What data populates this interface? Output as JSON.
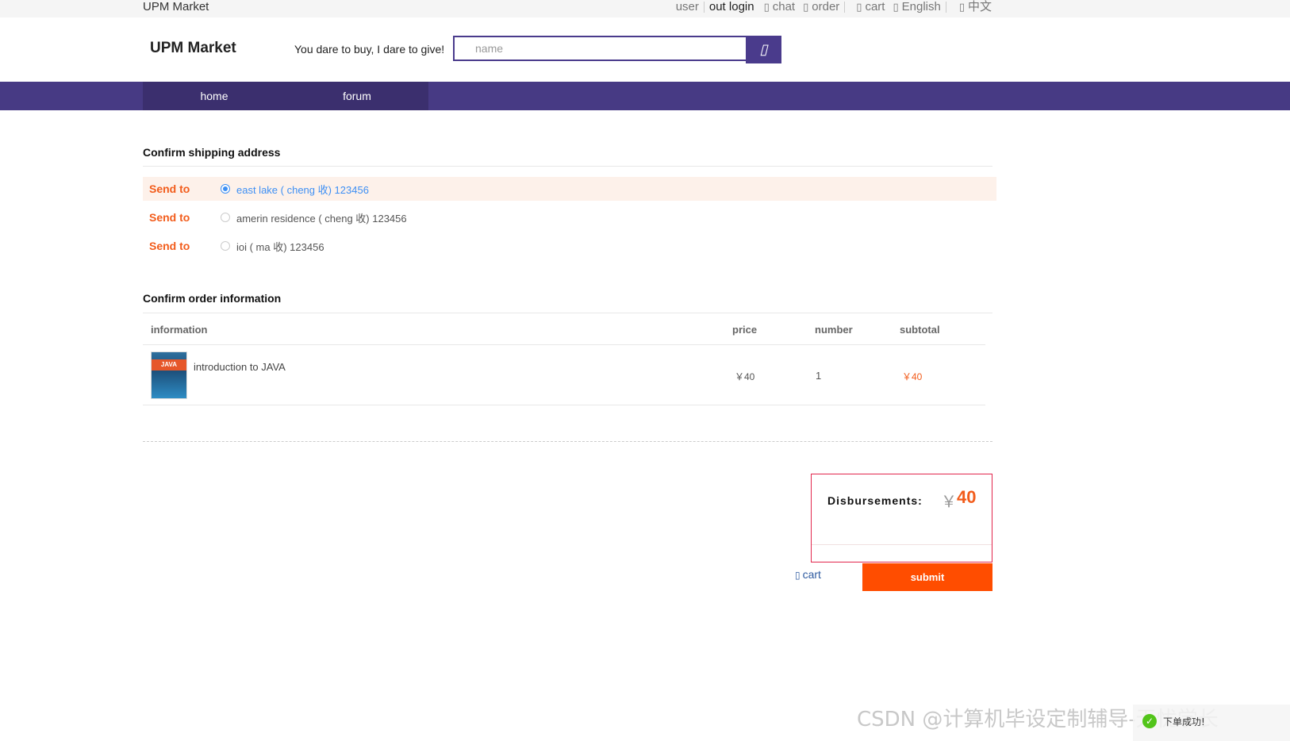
{
  "topbar": {
    "site": "UPM Market",
    "links": {
      "user": "user",
      "logout": "out login",
      "chat": "chat",
      "order": "order",
      "cart": "cart",
      "english": "English",
      "chinese": "中文"
    },
    "icon_glyph": "▯"
  },
  "header": {
    "logo": "UPM Market",
    "slogan": "You dare to buy, I dare to give!",
    "search_placeholder": "name",
    "search_icon": "search-icon"
  },
  "nav": {
    "items": [
      {
        "label": "home"
      },
      {
        "label": "forum"
      }
    ]
  },
  "shipping": {
    "title": "Confirm shipping address",
    "send_label": "Send to",
    "addresses": [
      {
        "text": "east lake ( cheng 收)  123456",
        "selected": true
      },
      {
        "text": "amerin residence ( cheng 收)  123456",
        "selected": false
      },
      {
        "text": "ioi ( ma 收)  123456",
        "selected": false
      }
    ]
  },
  "order": {
    "title": "Confirm order information",
    "columns": [
      "information",
      "price",
      "number",
      "subtotal"
    ],
    "items": [
      {
        "name": "introduction to JAVA",
        "cover_text": "JAVA",
        "price": "￥40",
        "number": "1",
        "subtotal": "￥40"
      }
    ]
  },
  "summary": {
    "label": "Disbursements:",
    "currency": "￥",
    "amount": "40",
    "back_to_cart": "cart",
    "submit": "submit"
  },
  "overlay": {
    "watermark": "CSDN @计算机毕设定制辅导-无忧学长",
    "toast": "下单成功!",
    "toast_check": "✓"
  },
  "colors": {
    "brand_purple": "#473a84",
    "accent_orange": "#ff4d00",
    "link_blue": "#3d8ff4"
  }
}
